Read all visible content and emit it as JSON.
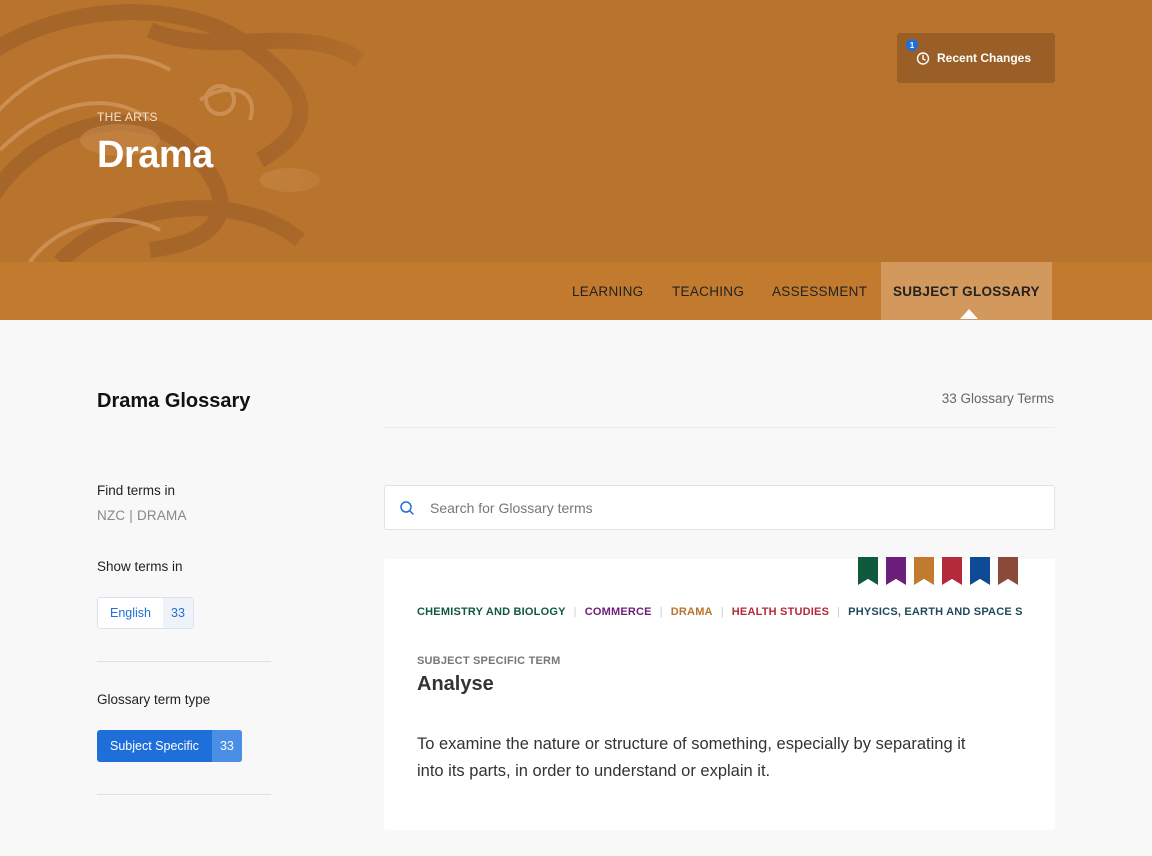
{
  "header": {
    "breadcrumb": "THE ARTS",
    "title": "Drama",
    "recent_changes": {
      "label": "Recent Changes",
      "badge": "1"
    }
  },
  "nav": {
    "items": [
      {
        "label": "LEARNING",
        "active": false
      },
      {
        "label": "TEACHING",
        "active": false
      },
      {
        "label": "ASSESSMENT",
        "active": false
      },
      {
        "label": "SUBJECT GLOSSARY",
        "active": true
      }
    ]
  },
  "glossary": {
    "title": "Drama Glossary",
    "count_label": "33 Glossary Terms"
  },
  "sidebar": {
    "find_terms_label": "Find terms in",
    "find_terms_value": "NZC | DRAMA",
    "show_terms_label": "Show terms in",
    "language": {
      "label": "English",
      "count": "33"
    },
    "term_type_label": "Glossary term type",
    "term_type": {
      "label": "Subject Specific",
      "count": "33"
    }
  },
  "search": {
    "placeholder": "Search for Glossary terms"
  },
  "card": {
    "subjects": [
      {
        "label": "CHEMISTRY AND BIOLOGY",
        "color": "#0f5a3c"
      },
      {
        "label": "COMMERCE",
        "color": "#6b1f7a"
      },
      {
        "label": "DRAMA",
        "color": "#b8732c"
      },
      {
        "label": "HEALTH STUDIES",
        "color": "#b52a3a"
      },
      {
        "label": "PHYSICS, EARTH AND SPACE SCIENCE",
        "color": "#1f4a5a"
      }
    ],
    "ribbon_colors": [
      "#0f5a3c",
      "#6b1f7a",
      "#c27a2e",
      "#b52a3a",
      "#0f4a96",
      "#8a4a3a"
    ],
    "term_type": "SUBJECT SPECIFIC TERM",
    "term": "Analyse",
    "definition": "To examine the nature or structure of something, especially by separating it into its parts, in order to understand or explain it."
  },
  "colors": {
    "banner": "#b8732c",
    "nav": "#c27a2e",
    "nav_active": "#d2985c",
    "accent": "#1e6fd9"
  }
}
